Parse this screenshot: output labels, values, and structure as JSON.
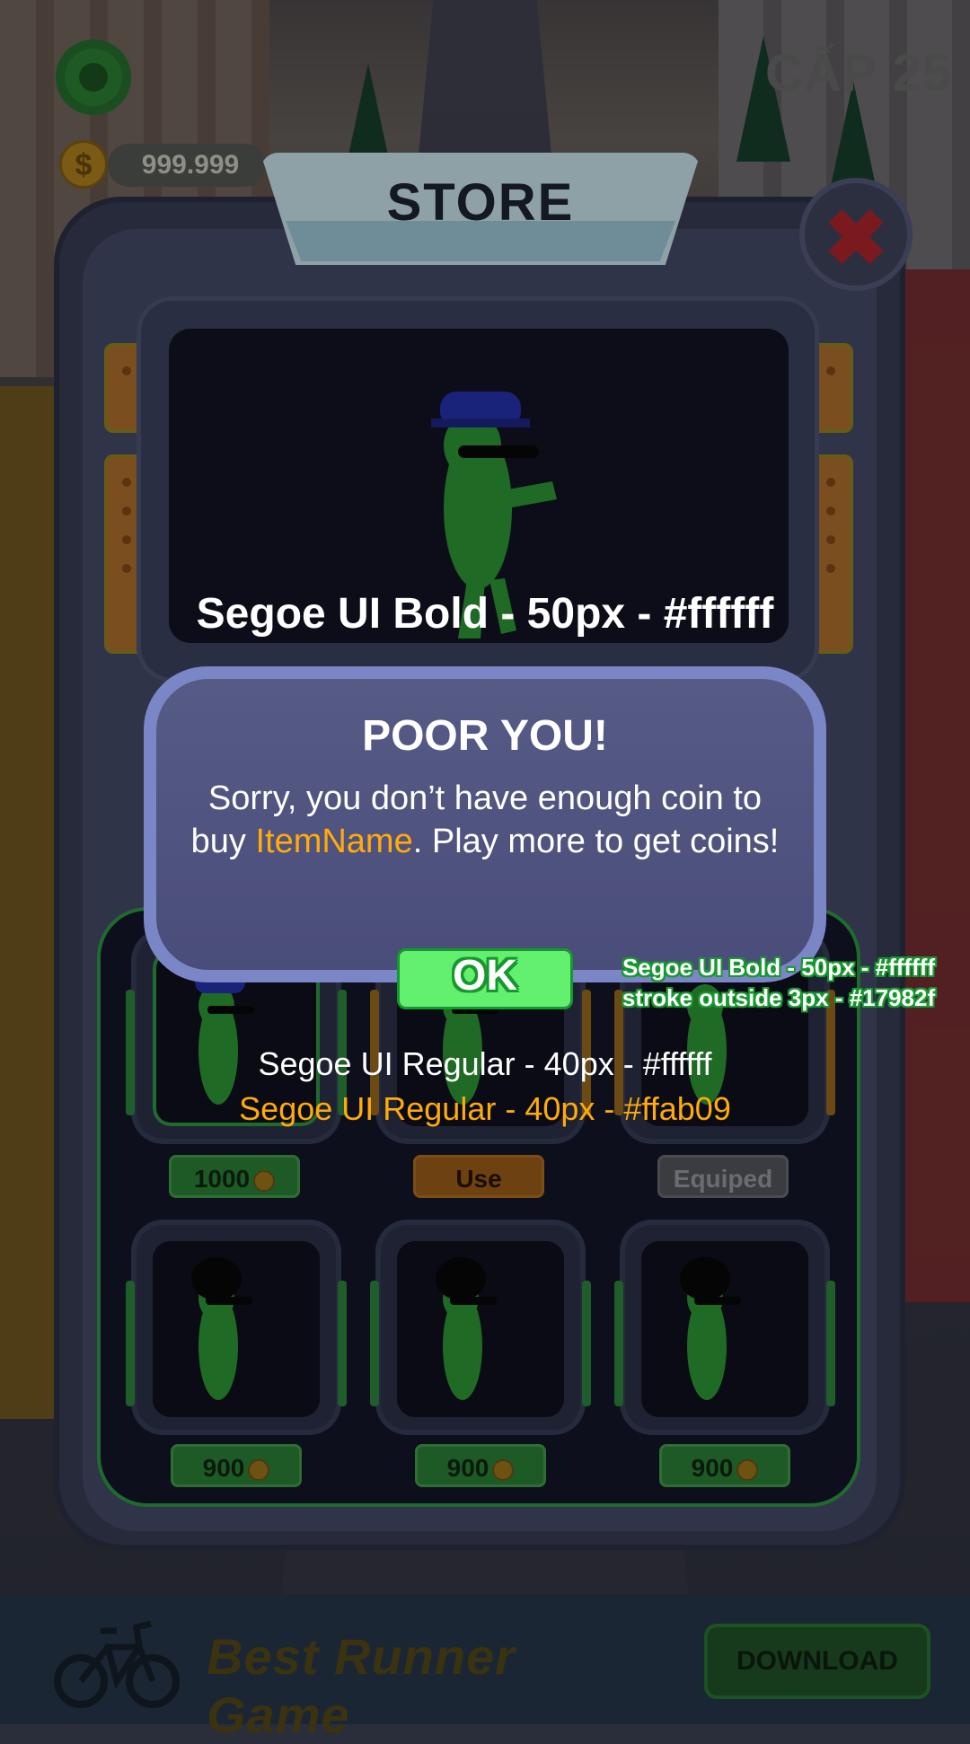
{
  "hud": {
    "coins": "999.999",
    "coin_symbol": "$",
    "level_label": "CẤP 25",
    "settings_icon": "gear-icon"
  },
  "store": {
    "title": "STORE",
    "close_symbol": "✖",
    "preview_label": "Segoe UI Bold - 50px - #ffffff"
  },
  "dialog": {
    "title": "POOR YOU!",
    "line_pre": "Sorry, you don’t have enough coin to buy ",
    "item_name": "ItemName",
    "line_post": ". Play more to get coins!",
    "ok_label": "OK",
    "ok_spec_line1": "Segoe UI Bold - 50px - #ffffff",
    "ok_spec_line2": "stroke outside 3px - #17982f",
    "spec_white": "Segoe UI Regular - 40px - #ffffff",
    "spec_orange": "Segoe UI Regular - 40px - #ffab09"
  },
  "items_row1": [
    {
      "price": "1000",
      "style": "green",
      "has_coin": true
    },
    {
      "price": "Use",
      "style": "orange",
      "has_coin": false
    },
    {
      "price": "Equiped",
      "style": "grey",
      "has_coin": false
    }
  ],
  "items_row2": [
    {
      "price": "900",
      "style": "green",
      "has_coin": true
    },
    {
      "price": "900",
      "style": "green",
      "has_coin": true
    },
    {
      "price": "900",
      "style": "green",
      "has_coin": true
    }
  ],
  "banner": {
    "title": "Best Runner Game",
    "download_label": "DOWNLOAD"
  },
  "colors": {
    "highlight": "#ffab09",
    "ok_stroke": "#17982f",
    "ok_fill": "#63f06e",
    "dialog_border": "#7b86c6",
    "dialog_fill": "#4a4d79"
  }
}
